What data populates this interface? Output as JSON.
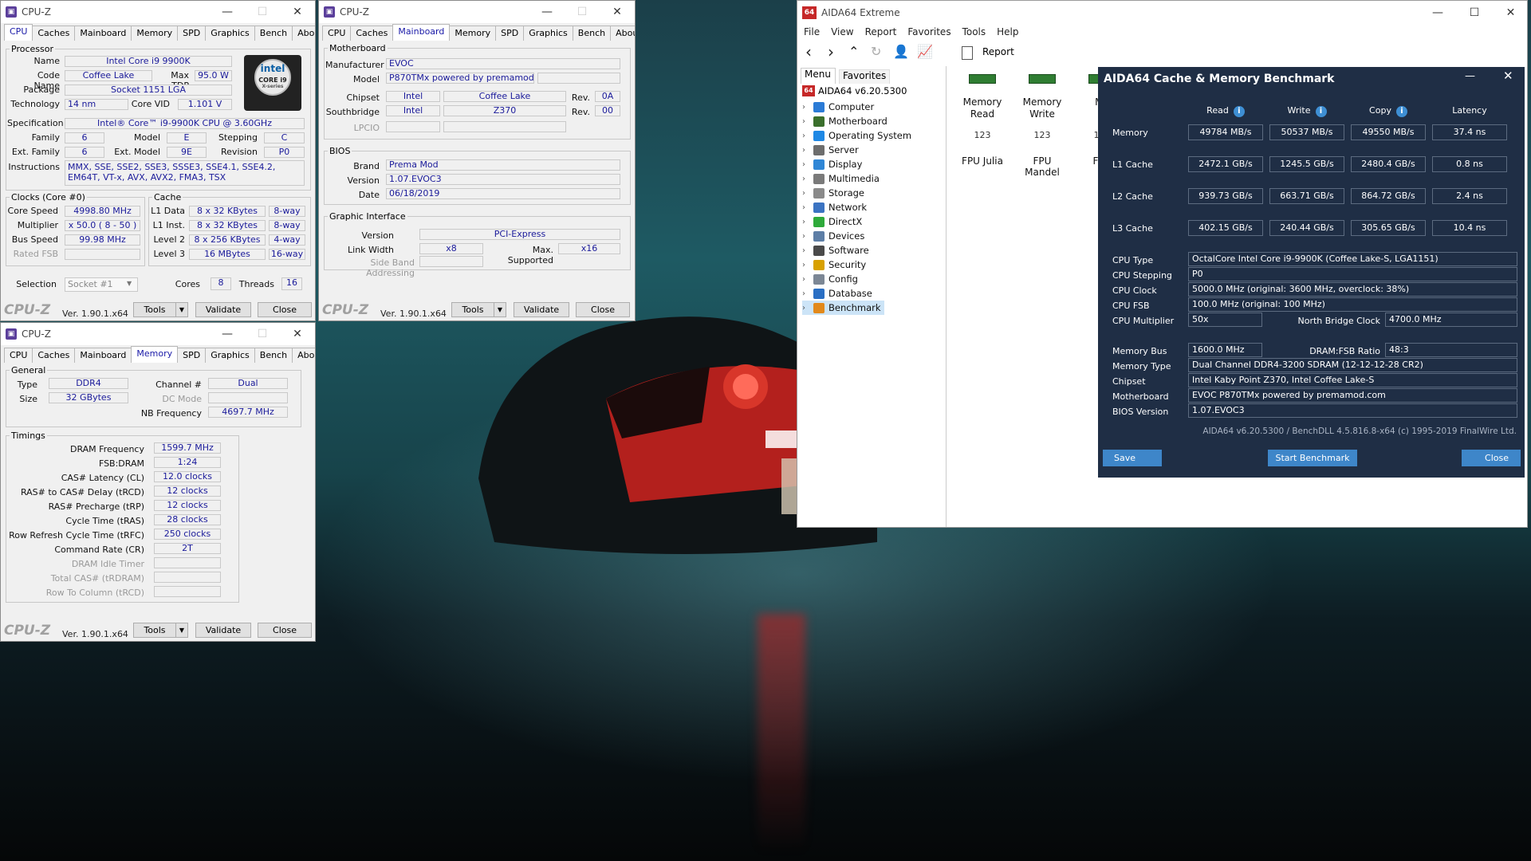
{
  "cpuz1": {
    "title": "CPU-Z",
    "tabs": [
      "CPU",
      "Caches",
      "Mainboard",
      "Memory",
      "SPD",
      "Graphics",
      "Bench",
      "About"
    ],
    "processor": {
      "section": "Processor",
      "name_label": "Name",
      "name": "Intel Core i9 9900K",
      "codename_label": "Code Name",
      "codename": "Coffee Lake",
      "maxtdp_label": "Max TDP",
      "maxtdp": "95.0 W",
      "package_label": "Package",
      "package": "Socket 1151 LGA",
      "technology_label": "Technology",
      "technology": "14 nm",
      "corevid_label": "Core VID",
      "corevid": "1.101 V",
      "spec_label": "Specification",
      "spec": "Intel® Core™ i9-9900K CPU @ 3.60GHz",
      "family_label": "Family",
      "family": "6",
      "model_label": "Model",
      "model": "E",
      "stepping_label": "Stepping",
      "stepping": "C",
      "extfamily_label": "Ext. Family",
      "extfamily": "6",
      "extmodel_label": "Ext. Model",
      "extmodel": "9E",
      "revision_label": "Revision",
      "revision": "P0",
      "instructions_label": "Instructions",
      "instructions": "MMX, SSE, SSE2, SSE3, SSSE3, SSE4.1, SSE4.2, EM64T, VT-x, AVX, AVX2, FMA3, TSX",
      "logo_brand": "intel",
      "logo_line1": "CORE i9",
      "logo_line2": "X-series"
    },
    "clocks": {
      "section": "Clocks (Core #0)",
      "corespeed_label": "Core Speed",
      "corespeed": "4998.80 MHz",
      "multiplier_label": "Multiplier",
      "multiplier": "x 50.0 ( 8 - 50 )",
      "busspeed_label": "Bus Speed",
      "busspeed": "99.98 MHz",
      "ratedfsb_label": "Rated FSB"
    },
    "cache": {
      "section": "Cache",
      "l1d_label": "L1 Data",
      "l1d": "8 x 32 KBytes",
      "l1d_way": "8-way",
      "l1i_label": "L1 Inst.",
      "l1i": "8 x 32 KBytes",
      "l1i_way": "8-way",
      "l2_label": "Level 2",
      "l2": "8 x 256 KBytes",
      "l2_way": "4-way",
      "l3_label": "Level 3",
      "l3": "16 MBytes",
      "l3_way": "16-way"
    },
    "selection_label": "Selection",
    "selection": "Socket #1",
    "cores_label": "Cores",
    "cores": "8",
    "threads_label": "Threads",
    "threads": "16"
  },
  "cpuz2": {
    "title": "CPU-Z",
    "tabs": [
      "CPU",
      "Caches",
      "Mainboard",
      "Memory",
      "SPD",
      "Graphics",
      "Bench",
      "About"
    ],
    "motherboard": {
      "section": "Motherboard",
      "manufacturer_label": "Manufacturer",
      "manufacturer": "EVOC",
      "model_label": "Model",
      "model": "P870TMx powered by premamod.com",
      "chipset_label": "Chipset",
      "chipset_vendor": "Intel",
      "chipset": "Coffee Lake",
      "chipset_rev_label": "Rev.",
      "chipset_rev": "0A",
      "southbridge_label": "Southbridge",
      "southbridge_vendor": "Intel",
      "southbridge": "Z370",
      "southbridge_rev_label": "Rev.",
      "southbridge_rev": "00",
      "lpcio_label": "LPCIO"
    },
    "bios": {
      "section": "BIOS",
      "brand_label": "Brand",
      "brand": "Prema Mod",
      "version_label": "Version",
      "version": "1.07.EVOC3",
      "date_label": "Date",
      "date": "06/18/2019"
    },
    "graphic": {
      "section": "Graphic Interface",
      "version_label": "Version",
      "version": "PCI-Express",
      "linkwidth_label": "Link Width",
      "linkwidth": "x8",
      "maxsupported_label": "Max. Supported",
      "maxsupported": "x16",
      "sideband_label": "Side Band Addressing"
    }
  },
  "cpuz3": {
    "title": "CPU-Z",
    "tabs": [
      "CPU",
      "Caches",
      "Mainboard",
      "Memory",
      "SPD",
      "Graphics",
      "Bench",
      "About"
    ],
    "general": {
      "section": "General",
      "type_label": "Type",
      "type": "DDR4",
      "size_label": "Size",
      "size": "32 GBytes",
      "channel_label": "Channel #",
      "channel": "Dual",
      "dcmode_label": "DC Mode",
      "nbfreq_label": "NB Frequency",
      "nbfreq": "4697.7 MHz"
    },
    "timings": {
      "section": "Timings",
      "rows": [
        {
          "label": "DRAM Frequency",
          "value": "1599.7 MHz"
        },
        {
          "label": "FSB:DRAM",
          "value": "1:24"
        },
        {
          "label": "CAS# Latency (CL)",
          "value": "12.0 clocks"
        },
        {
          "label": "RAS# to CAS# Delay (tRCD)",
          "value": "12 clocks"
        },
        {
          "label": "RAS# Precharge (tRP)",
          "value": "12 clocks"
        },
        {
          "label": "Cycle Time (tRAS)",
          "value": "28 clocks"
        },
        {
          "label": "Row Refresh Cycle Time (tRFC)",
          "value": "250 clocks"
        },
        {
          "label": "Command Rate (CR)",
          "value": "2T"
        },
        {
          "label": "DRAM Idle Timer",
          "value": ""
        },
        {
          "label": "Total CAS# (tRDRAM)",
          "value": ""
        },
        {
          "label": "Row To Column (tRCD)",
          "value": ""
        }
      ]
    }
  },
  "cpuz_footer": {
    "logo": "CPU-Z",
    "version": "Ver. 1.90.1.x64",
    "tools": "Tools",
    "validate": "Validate",
    "close": "Close"
  },
  "aida": {
    "title": "AIDA64 Extreme",
    "app_icon": "64",
    "menu": [
      "File",
      "View",
      "Report",
      "Favorites",
      "Tools",
      "Help"
    ],
    "report_label": "Report",
    "panel_tabs": [
      "Menu",
      "Favorites"
    ],
    "tree_root": "AIDA64 v6.20.5300",
    "tree": [
      {
        "label": "Computer",
        "color": "#2b7bd6"
      },
      {
        "label": "Motherboard",
        "color": "#3a6f2c"
      },
      {
        "label": "Operating System",
        "color": "#1e88e5"
      },
      {
        "label": "Server",
        "color": "#6d6d6d"
      },
      {
        "label": "Display",
        "color": "#2f86d6"
      },
      {
        "label": "Multimedia",
        "color": "#7a7a7a"
      },
      {
        "label": "Storage",
        "color": "#8a8a8a"
      },
      {
        "label": "Network",
        "color": "#3b73c2"
      },
      {
        "label": "DirectX",
        "color": "#2eaa3a"
      },
      {
        "label": "Devices",
        "color": "#5d7ea6"
      },
      {
        "label": "Software",
        "color": "#4a4a4a"
      },
      {
        "label": "Security",
        "color": "#d8a100"
      },
      {
        "label": "Config",
        "color": "#7c8795"
      },
      {
        "label": "Database",
        "color": "#2a6fc4"
      },
      {
        "label": "Benchmark",
        "color": "#e2891b"
      }
    ],
    "bench_icons": [
      {
        "line1": "Memory",
        "line2": "Read"
      },
      {
        "line1": "Memory",
        "line2": "Write"
      },
      {
        "line1": "Me",
        "line2": "C"
      }
    ],
    "fpu_icons": [
      "FPU Julia",
      "FPU Mandel",
      "FPU"
    ]
  },
  "bench": {
    "title": "AIDA64 Cache & Memory Benchmark",
    "headers": [
      "Read",
      "Write",
      "Copy",
      "Latency"
    ],
    "rows": [
      {
        "label": "Memory",
        "read": "49784 MB/s",
        "write": "50537 MB/s",
        "copy": "49550 MB/s",
        "latency": "37.4 ns"
      },
      {
        "label": "L1 Cache",
        "read": "2472.1 GB/s",
        "write": "1245.5 GB/s",
        "copy": "2480.4 GB/s",
        "latency": "0.8 ns"
      },
      {
        "label": "L2 Cache",
        "read": "939.73 GB/s",
        "write": "663.71 GB/s",
        "copy": "864.72 GB/s",
        "latency": "2.4 ns"
      },
      {
        "label": "L3 Cache",
        "read": "402.15 GB/s",
        "write": "240.44 GB/s",
        "copy": "305.65 GB/s",
        "latency": "10.4 ns"
      }
    ],
    "info": {
      "cputype_label": "CPU Type",
      "cputype": "OctalCore Intel Core i9-9900K  (Coffee Lake-S, LGA1151)",
      "stepping_label": "CPU Stepping",
      "stepping": "P0",
      "clock_label": "CPU Clock",
      "clock": "5000.0 MHz  (original: 3600 MHz, overclock: 38%)",
      "fsb_label": "CPU FSB",
      "fsb": "100.0 MHz  (original: 100 MHz)",
      "mult_label": "CPU Multiplier",
      "mult": "50x",
      "nbclock_label": "North Bridge Clock",
      "nbclock": "4700.0 MHz",
      "membus_label": "Memory Bus",
      "membus": "1600.0 MHz",
      "ratio_label": "DRAM:FSB Ratio",
      "ratio": "48:3",
      "memtype_label": "Memory Type",
      "memtype": "Dual Channel DDR4-3200 SDRAM  (12-12-12-28 CR2)",
      "chipset_label": "Chipset",
      "chipset": "Intel Kaby Point Z370, Intel Coffee Lake-S",
      "mobo_label": "Motherboard",
      "mobo": "EVOC P870TMx powered by premamod.com",
      "bios_label": "BIOS Version",
      "bios": "1.07.EVOC3"
    },
    "footer_text": "AIDA64 v6.20.5300 / BenchDLL 4.5.816.8-x64  (c) 1995-2019 FinalWire Ltd.",
    "save": "Save",
    "start": "Start Benchmark",
    "close": "Close"
  }
}
